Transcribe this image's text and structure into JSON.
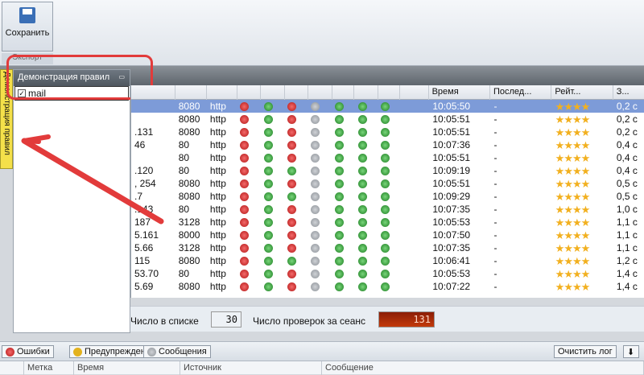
{
  "toolbar": {
    "save_label": "Сохранить",
    "group_label": "Экспорт"
  },
  "side_tab": {
    "label": "Демонстрация правил"
  },
  "left_panel": {
    "title": "Демонстрация правил",
    "item_label": "mail"
  },
  "grid": {
    "columns": [
      "",
      "",
      "",
      "",
      "",
      "",
      "",
      "",
      "",
      "",
      "",
      "Время",
      "Послед...",
      "Рейт...",
      "З..."
    ],
    "rows": [
      {
        "addr": "",
        "port": "8080",
        "proto": "http",
        "icons": [
          "r",
          "g",
          "r",
          "q",
          "g",
          "g",
          "g"
        ],
        "time": "10:05:50",
        "last": "-",
        "rating": "★★★★",
        "extra": "0,2 c"
      },
      {
        "addr": "",
        "port": "8080",
        "proto": "http",
        "icons": [
          "r",
          "g",
          "r",
          "q",
          "g",
          "g",
          "g"
        ],
        "time": "10:05:51",
        "last": "-",
        "rating": "★★★★",
        "extra": "0,2 c"
      },
      {
        "addr": ".131",
        "port": "8080",
        "proto": "http",
        "icons": [
          "r",
          "g",
          "r",
          "q",
          "g",
          "g",
          "g"
        ],
        "time": "10:05:51",
        "last": "-",
        "rating": "★★★★",
        "extra": "0,2 c"
      },
      {
        "addr": "46",
        "port": "80",
        "proto": "http",
        "icons": [
          "r",
          "g",
          "r",
          "q",
          "g",
          "g",
          "g"
        ],
        "time": "10:07:36",
        "last": "-",
        "rating": "★★★★",
        "extra": "0,4 c"
      },
      {
        "addr": "",
        "port": "80",
        "proto": "http",
        "icons": [
          "r",
          "g",
          "r",
          "q",
          "g",
          "g",
          "g"
        ],
        "time": "10:05:51",
        "last": "-",
        "rating": "★★★★",
        "extra": "0,4 c"
      },
      {
        "addr": ".120",
        "port": "80",
        "proto": "http",
        "icons": [
          "r",
          "g",
          "g",
          "q",
          "g",
          "g",
          "g"
        ],
        "time": "10:09:19",
        "last": "-",
        "rating": "★★★★",
        "extra": "0,4 c"
      },
      {
        "addr": ", 254",
        "port": "8080",
        "proto": "http",
        "icons": [
          "r",
          "g",
          "r",
          "q",
          "g",
          "g",
          "g"
        ],
        "time": "10:05:51",
        "last": "-",
        "rating": "★★★★",
        "extra": "0,5 c"
      },
      {
        "addr": ".7",
        "port": "8080",
        "proto": "http",
        "icons": [
          "r",
          "g",
          "g",
          "q",
          "g",
          "g",
          "g"
        ],
        "time": "10:09:29",
        "last": "-",
        "rating": "★★★★",
        "extra": "0,5 c"
      },
      {
        "addr": ".143",
        "port": "80",
        "proto": "http",
        "icons": [
          "r",
          "g",
          "r",
          "q",
          "g",
          "g",
          "g"
        ],
        "time": "10:07:35",
        "last": "-",
        "rating": "★★★★",
        "extra": "1,0 c"
      },
      {
        "addr": "187",
        "port": "3128",
        "proto": "http",
        "icons": [
          "r",
          "g",
          "r",
          "q",
          "g",
          "g",
          "g"
        ],
        "time": "10:05:53",
        "last": "-",
        "rating": "★★★★",
        "extra": "1,1 c"
      },
      {
        "addr": "5.161",
        "port": "8000",
        "proto": "http",
        "icons": [
          "r",
          "g",
          "r",
          "q",
          "g",
          "g",
          "g"
        ],
        "time": "10:07:50",
        "last": "-",
        "rating": "★★★★",
        "extra": "1,1 c"
      },
      {
        "addr": "5.66",
        "port": "3128",
        "proto": "http",
        "icons": [
          "r",
          "g",
          "r",
          "q",
          "g",
          "g",
          "g"
        ],
        "time": "10:07:35",
        "last": "-",
        "rating": "★★★★",
        "extra": "1,1 c"
      },
      {
        "addr": "115",
        "port": "8080",
        "proto": "http",
        "icons": [
          "r",
          "g",
          "g",
          "q",
          "g",
          "g",
          "g"
        ],
        "time": "10:06:41",
        "last": "-",
        "rating": "★★★★",
        "extra": "1,2 c"
      },
      {
        "addr": "53.70",
        "port": "80",
        "proto": "http",
        "icons": [
          "r",
          "g",
          "r",
          "q",
          "g",
          "g",
          "g"
        ],
        "time": "10:05:53",
        "last": "-",
        "rating": "★★★★",
        "extra": "1,4 c"
      },
      {
        "addr": "5.69",
        "port": "8080",
        "proto": "http",
        "icons": [
          "r",
          "g",
          "r",
          "q",
          "g",
          "g",
          "g"
        ],
        "time": "10:07:22",
        "last": "-",
        "rating": "★★★★",
        "extra": "1,4 c"
      }
    ]
  },
  "stats": {
    "list_label": "Число в списке",
    "list_value": "30",
    "checks_label": "Число проверок за сеанс",
    "checks_value": "131"
  },
  "bottom": {
    "errors": "Ошибки",
    "warnings": "Предупреждения",
    "messages": "Сообщения",
    "clear_log": "Очистить лог",
    "columns": [
      "Метка",
      "Время",
      "Источник",
      "Сообщение"
    ]
  }
}
